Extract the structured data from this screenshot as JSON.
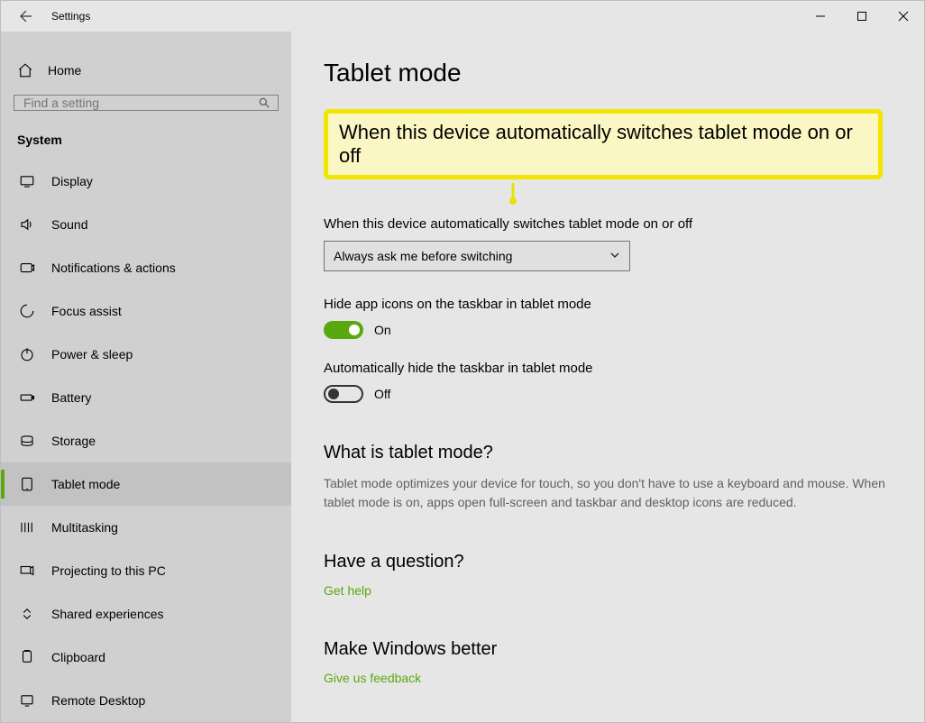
{
  "titlebar": {
    "app_name": "Settings"
  },
  "sidebar": {
    "home_label": "Home",
    "search_placeholder": "Find a setting",
    "section_label": "System",
    "items": [
      {
        "label": "Display"
      },
      {
        "label": "Sound"
      },
      {
        "label": "Notifications & actions"
      },
      {
        "label": "Focus assist"
      },
      {
        "label": "Power & sleep"
      },
      {
        "label": "Battery"
      },
      {
        "label": "Storage"
      },
      {
        "label": "Tablet mode"
      },
      {
        "label": "Multitasking"
      },
      {
        "label": "Projecting to this PC"
      },
      {
        "label": "Shared experiences"
      },
      {
        "label": "Clipboard"
      },
      {
        "label": "Remote Desktop"
      }
    ],
    "selected_index": 7
  },
  "content": {
    "page_title": "Tablet mode",
    "highlighted_text": "When this device automatically switches tablet mode on or off",
    "switch_label": "When this device automatically switches tablet mode on or off",
    "switch_value": "Always ask me before switching",
    "hide_icons_label": "Hide app icons on the taskbar in tablet mode",
    "hide_icons_state": "On",
    "auto_hide_label": "Automatically hide the taskbar in tablet mode",
    "auto_hide_state": "Off",
    "what_is_head": "What is tablet mode?",
    "what_is_body": "Tablet mode optimizes your device for touch, so you don't have to use a keyboard and mouse. When tablet mode is on, apps open full-screen and taskbar and desktop icons are reduced.",
    "question_head": "Have a question?",
    "get_help_link": "Get help",
    "better_head": "Make Windows better",
    "feedback_link": "Give us feedback"
  }
}
